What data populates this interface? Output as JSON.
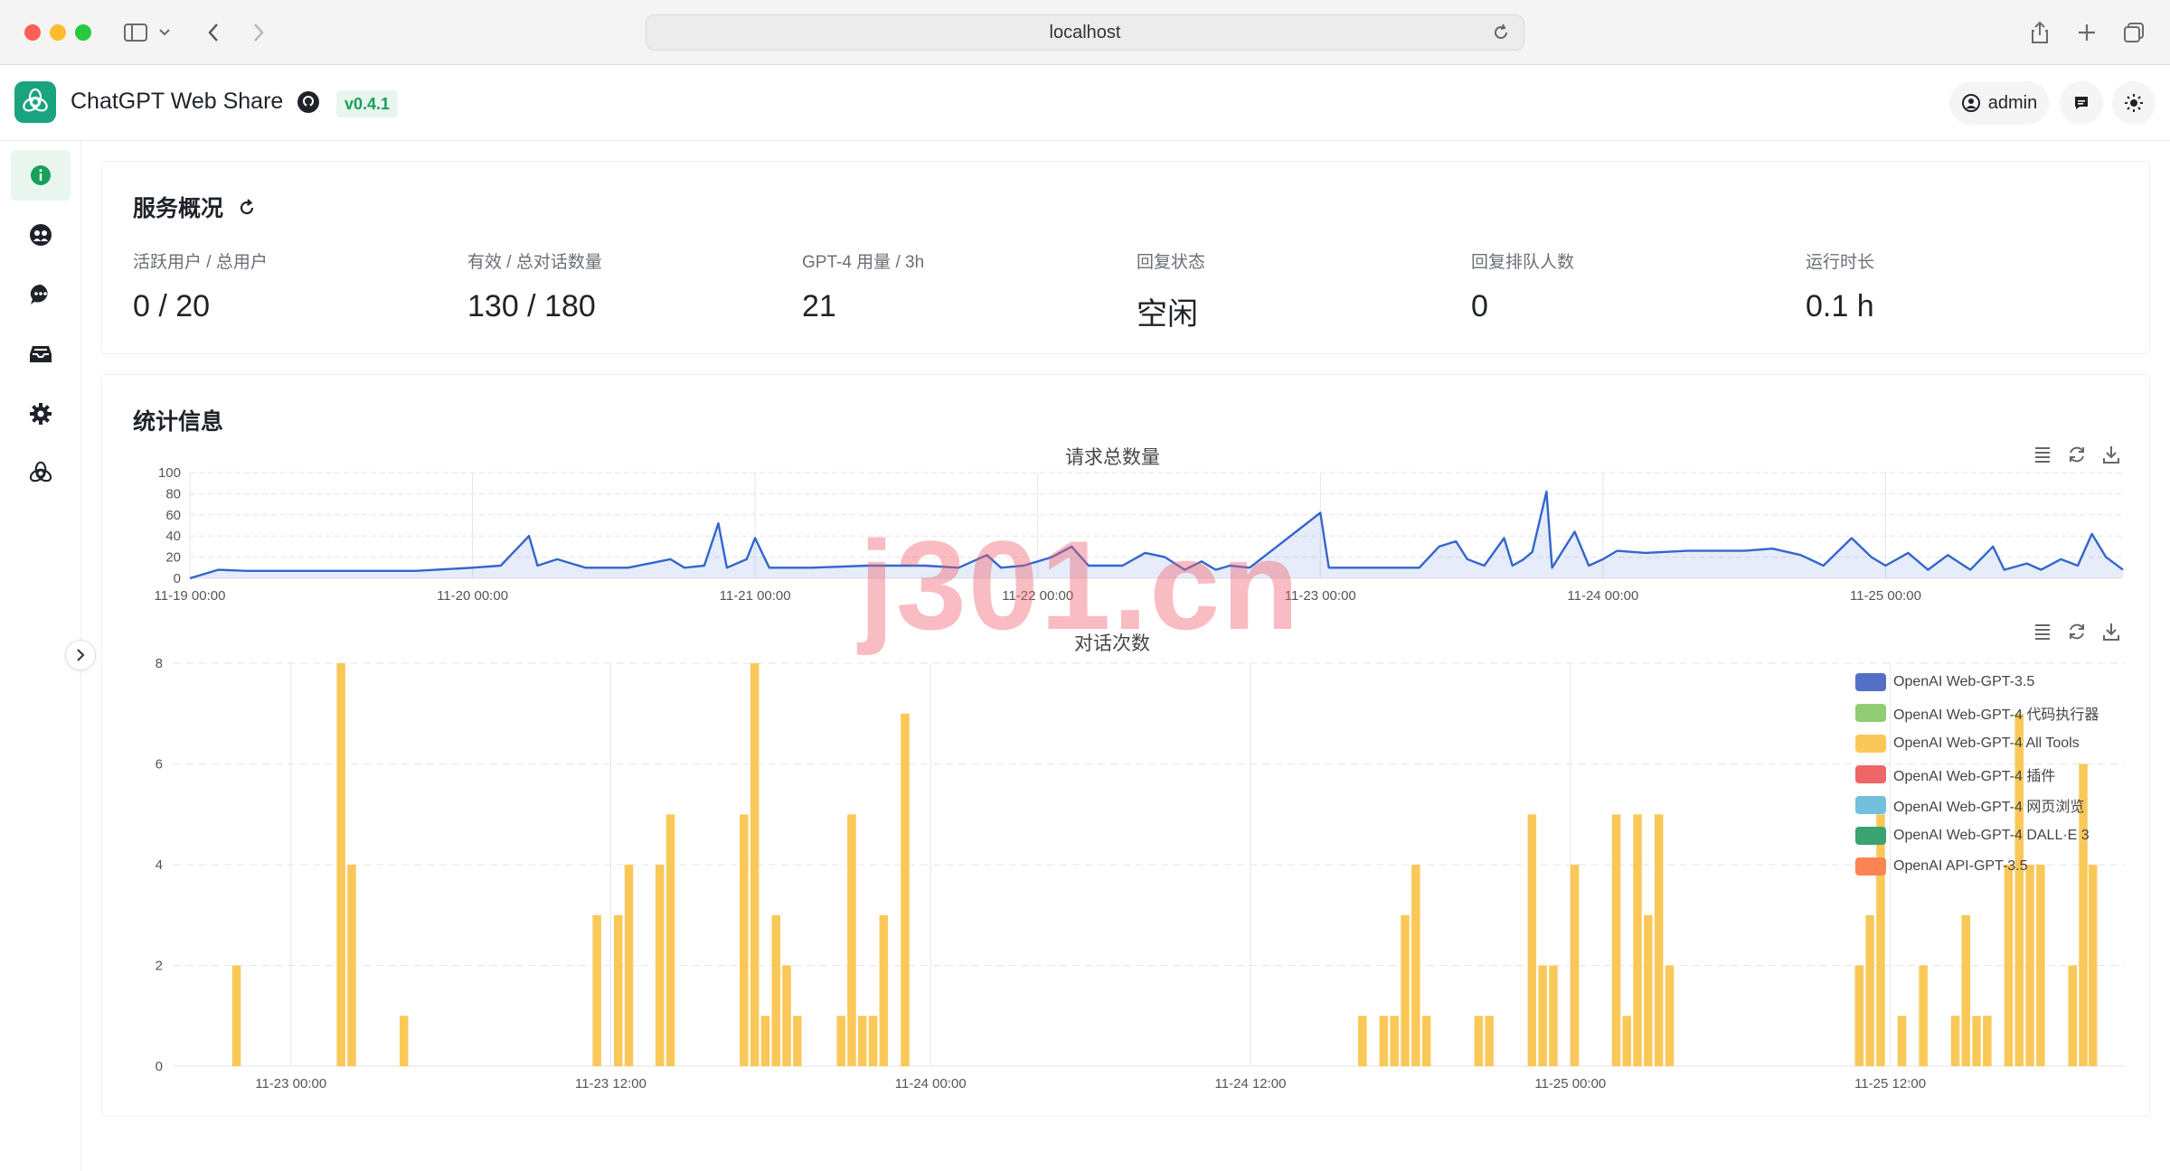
{
  "browser": {
    "url": "localhost"
  },
  "app": {
    "title": "ChatGPT Web Share",
    "version": "v0.4.1",
    "user": "admin"
  },
  "overview": {
    "title": "服务概况",
    "stats": [
      {
        "label": "活跃用户 / 总用户",
        "value": "0 / 20"
      },
      {
        "label": "有效 / 总对话数量",
        "value": "130 / 180"
      },
      {
        "label": "GPT-4 用量 / 3h",
        "value": "21"
      },
      {
        "label": "回复状态",
        "value": "空闲"
      },
      {
        "label": "回复排队人数",
        "value": "0"
      },
      {
        "label": "运行时长",
        "value": "0.1 h"
      }
    ]
  },
  "statistics": {
    "title": "统计信息"
  },
  "watermark": "j301.cn",
  "colors": {
    "accent": "#18a058",
    "line": "#3366cc",
    "bar": "#f8c653"
  },
  "chart_data": [
    {
      "type": "area",
      "title": "请求总数量",
      "ylim": [
        0,
        100
      ],
      "yticks": [
        0,
        20,
        40,
        60,
        80,
        100
      ],
      "x_ticks": [
        "11-19 00:00",
        "11-20 00:00",
        "11-21 00:00",
        "11-22 00:00",
        "11-23 00:00",
        "11-24 00:00",
        "11-25 00:00"
      ],
      "x_range": [
        0,
        6.84
      ],
      "points": [
        [
          0,
          0
        ],
        [
          0.1,
          8
        ],
        [
          0.2,
          7
        ],
        [
          0.4,
          7
        ],
        [
          0.6,
          7
        ],
        [
          0.8,
          7
        ],
        [
          1.0,
          10
        ],
        [
          1.1,
          12
        ],
        [
          1.2,
          40
        ],
        [
          1.23,
          12
        ],
        [
          1.3,
          18
        ],
        [
          1.4,
          10
        ],
        [
          1.55,
          10
        ],
        [
          1.7,
          18
        ],
        [
          1.75,
          10
        ],
        [
          1.82,
          12
        ],
        [
          1.87,
          52
        ],
        [
          1.9,
          10
        ],
        [
          1.97,
          18
        ],
        [
          2.0,
          38
        ],
        [
          2.05,
          10
        ],
        [
          2.2,
          10
        ],
        [
          2.4,
          12
        ],
        [
          2.6,
          12
        ],
        [
          2.72,
          10
        ],
        [
          2.82,
          22
        ],
        [
          2.87,
          10
        ],
        [
          2.95,
          12
        ],
        [
          3.05,
          20
        ],
        [
          3.12,
          30
        ],
        [
          3.18,
          12
        ],
        [
          3.3,
          12
        ],
        [
          3.38,
          24
        ],
        [
          3.45,
          20
        ],
        [
          3.52,
          8
        ],
        [
          3.58,
          16
        ],
        [
          3.63,
          8
        ],
        [
          3.68,
          12
        ],
        [
          3.75,
          10
        ],
        [
          4.0,
          62
        ],
        [
          4.03,
          10
        ],
        [
          4.1,
          10
        ],
        [
          4.25,
          10
        ],
        [
          4.35,
          10
        ],
        [
          4.42,
          30
        ],
        [
          4.48,
          35
        ],
        [
          4.52,
          18
        ],
        [
          4.58,
          12
        ],
        [
          4.65,
          38
        ],
        [
          4.68,
          12
        ],
        [
          4.72,
          18
        ],
        [
          4.75,
          25
        ],
        [
          4.8,
          82
        ],
        [
          4.82,
          10
        ],
        [
          4.9,
          44
        ],
        [
          4.95,
          12
        ],
        [
          5.0,
          18
        ],
        [
          5.05,
          26
        ],
        [
          5.15,
          24
        ],
        [
          5.3,
          26
        ],
        [
          5.5,
          26
        ],
        [
          5.6,
          28
        ],
        [
          5.7,
          22
        ],
        [
          5.78,
          12
        ],
        [
          5.88,
          38
        ],
        [
          5.95,
          20
        ],
        [
          6.0,
          12
        ],
        [
          6.08,
          24
        ],
        [
          6.15,
          8
        ],
        [
          6.22,
          22
        ],
        [
          6.3,
          8
        ],
        [
          6.38,
          30
        ],
        [
          6.42,
          8
        ],
        [
          6.5,
          14
        ],
        [
          6.55,
          8
        ],
        [
          6.62,
          18
        ],
        [
          6.68,
          12
        ],
        [
          6.73,
          42
        ],
        [
          6.78,
          20
        ],
        [
          6.84,
          8
        ]
      ]
    },
    {
      "type": "bar",
      "title": "对话次数",
      "ylim": [
        0,
        8
      ],
      "yticks": [
        0,
        2,
        4,
        6,
        8
      ],
      "x_ticks": [
        "11-23 00:00",
        "11-23 12:00",
        "11-24 00:00",
        "11-24 12:00",
        "11-25 00:00",
        "11-25 12:00"
      ],
      "series": [
        {
          "name": "OpenAI Web-GPT-3.5",
          "color": "#5470c6",
          "values": []
        },
        {
          "name": "OpenAI Web-GPT-4 代码执行器",
          "color": "#91cc75",
          "values": []
        },
        {
          "name": "OpenAI Web-GPT-4 All Tools",
          "color": "#fac858",
          "values": [
            [
              0.59,
              2
            ],
            [
              1.57,
              8
            ],
            [
              1.67,
              4
            ],
            [
              2.16,
              1
            ],
            [
              3.97,
              3
            ],
            [
              4.17,
              3
            ],
            [
              4.27,
              4
            ],
            [
              4.56,
              4
            ],
            [
              4.66,
              5
            ],
            [
              5.35,
              5
            ],
            [
              5.45,
              8
            ],
            [
              5.55,
              1
            ],
            [
              5.65,
              3
            ],
            [
              5.75,
              2
            ],
            [
              5.85,
              1
            ],
            [
              6.26,
              1
            ],
            [
              6.36,
              5
            ],
            [
              6.46,
              1
            ],
            [
              6.56,
              1
            ],
            [
              6.66,
              3
            ],
            [
              6.86,
              7
            ],
            [
              11.15,
              1
            ],
            [
              11.35,
              1
            ],
            [
              11.45,
              1
            ],
            [
              11.55,
              3
            ],
            [
              11.65,
              4
            ],
            [
              11.75,
              1
            ],
            [
              12.24,
              1
            ],
            [
              12.34,
              1
            ],
            [
              12.74,
              5
            ],
            [
              12.84,
              2
            ],
            [
              12.94,
              2
            ],
            [
              13.14,
              4
            ],
            [
              13.53,
              5
            ],
            [
              13.63,
              1
            ],
            [
              13.73,
              5
            ],
            [
              13.83,
              3
            ],
            [
              13.93,
              5
            ],
            [
              14.03,
              2
            ],
            [
              15.81,
              2
            ],
            [
              15.91,
              3
            ],
            [
              16.01,
              5
            ],
            [
              16.21,
              1
            ],
            [
              16.41,
              2
            ],
            [
              16.71,
              1
            ],
            [
              16.81,
              3
            ],
            [
              16.91,
              1
            ],
            [
              17.01,
              1
            ],
            [
              17.21,
              4
            ],
            [
              17.31,
              7
            ],
            [
              17.41,
              4
            ],
            [
              17.51,
              4
            ],
            [
              17.81,
              2
            ],
            [
              17.91,
              6
            ],
            [
              18.0,
              4
            ]
          ]
        },
        {
          "name": "OpenAI Web-GPT-4 插件",
          "color": "#ee6666",
          "values": []
        },
        {
          "name": "OpenAI Web-GPT-4 网页浏览",
          "color": "#73c0de",
          "values": []
        },
        {
          "name": "OpenAI Web-GPT-4 DALL·E 3",
          "color": "#3ba272",
          "values": []
        },
        {
          "name": "OpenAI API-GPT-3.5",
          "color": "#fc8452",
          "values": []
        }
      ]
    }
  ]
}
